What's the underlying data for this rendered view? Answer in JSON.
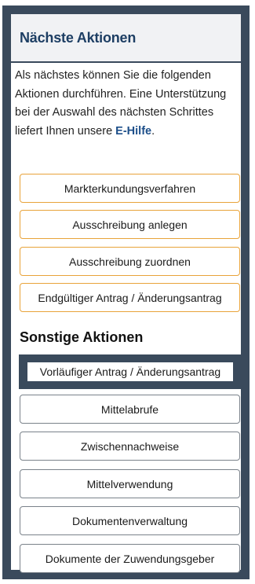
{
  "header": {
    "title": "Nächste Aktionen"
  },
  "intro": {
    "text": "Als nächstes können Sie die folgenden Aktionen durchführen. Eine Unterstützung bei der Auswahl des nächsten Schrittes liefert Ihnen unsere ",
    "link": "E-Hilfe",
    "suffix": "."
  },
  "next_actions": [
    {
      "label": "Markterkundungsverfahren"
    },
    {
      "label": "Ausschreibung anlegen"
    },
    {
      "label": "Ausschreibung zuordnen"
    },
    {
      "label": "Endgültiger Antrag / Änderungsantrag"
    }
  ],
  "other": {
    "title": "Sonstige Aktionen",
    "actions": [
      {
        "label": "Vorläufiger Antrag / Änderungsantrag",
        "active": true
      },
      {
        "label": "Mittelabrufe"
      },
      {
        "label": "Zwischennachweise"
      },
      {
        "label": "Mittelverwendung"
      },
      {
        "label": "Dokumentenverwaltung"
      },
      {
        "label": "Dokumente der Zuwendungsgeber"
      }
    ]
  },
  "colors": {
    "panel": "#3a4a5c",
    "header_bg": "#f1f2f4",
    "title": "#1d3e63",
    "link": "#1d4f8a",
    "orange_border": "#e8a33a",
    "grey_border": "#7a828a"
  }
}
